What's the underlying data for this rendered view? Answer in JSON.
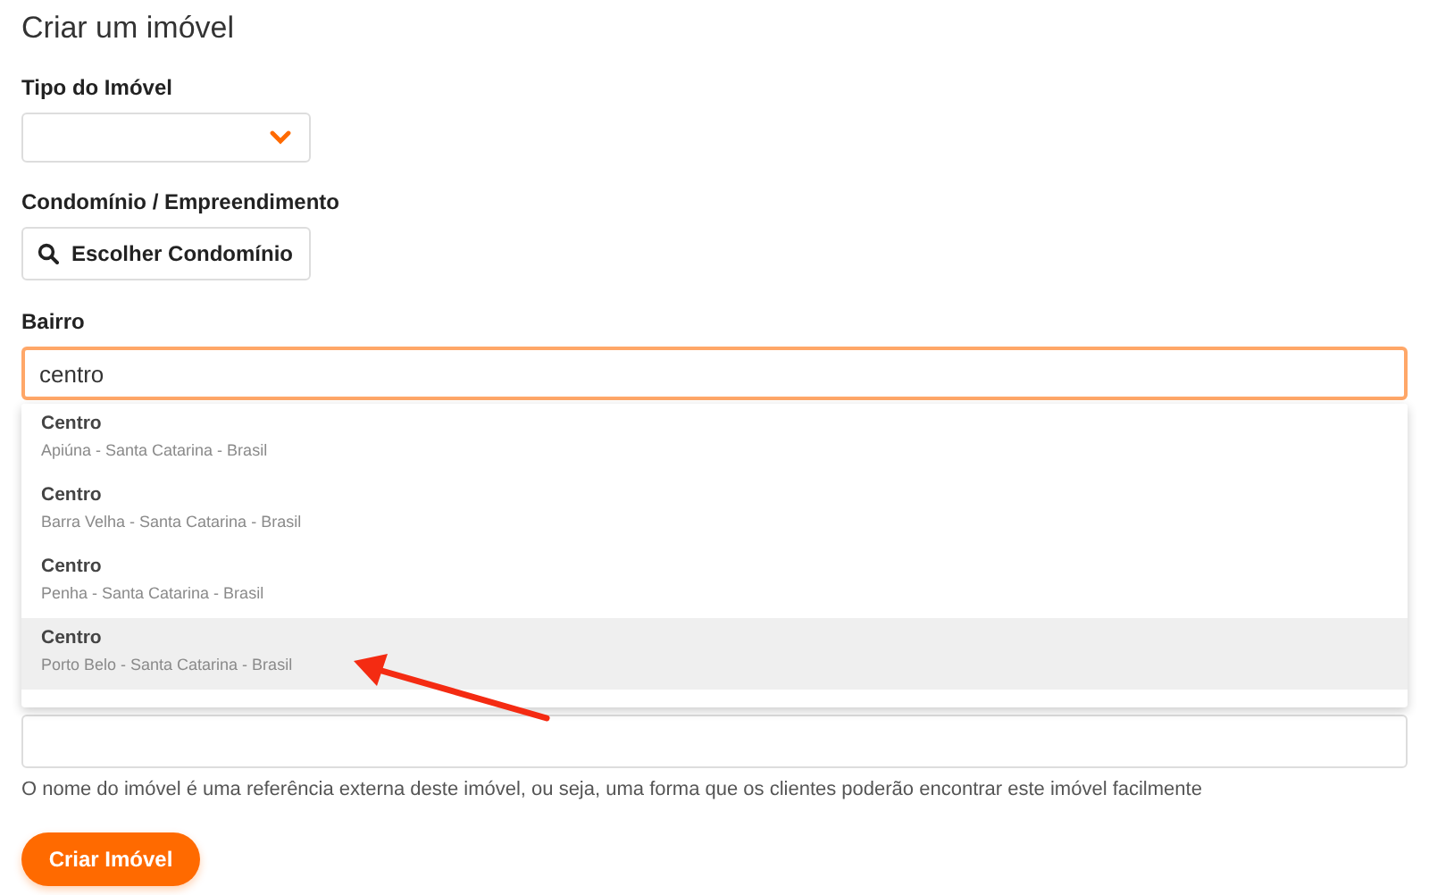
{
  "title": "Criar um imóvel",
  "property_type": {
    "label": "Tipo do Imóvel"
  },
  "condominium": {
    "label": "Condomínio / Empreendimento",
    "button": "Escolher Condomínio"
  },
  "neighborhood": {
    "label": "Bairro",
    "value": "centro",
    "suggestions": [
      {
        "name": "Centro",
        "location": "Apiúna - Santa Catarina - Brasil",
        "selected": false
      },
      {
        "name": "Centro",
        "location": "Barra Velha - Santa Catarina - Brasil",
        "selected": false
      },
      {
        "name": "Centro",
        "location": "Penha - Santa Catarina - Brasil",
        "selected": false
      },
      {
        "name": "Centro",
        "location": "Porto Belo - Santa Catarina - Brasil",
        "selected": true
      }
    ]
  },
  "name_field": {
    "help": "O nome do imóvel é uma referência externa deste imóvel, ou seja, uma forma que os clientes poderão encontrar este imóvel facilmente"
  },
  "submit": "Criar Imóvel"
}
